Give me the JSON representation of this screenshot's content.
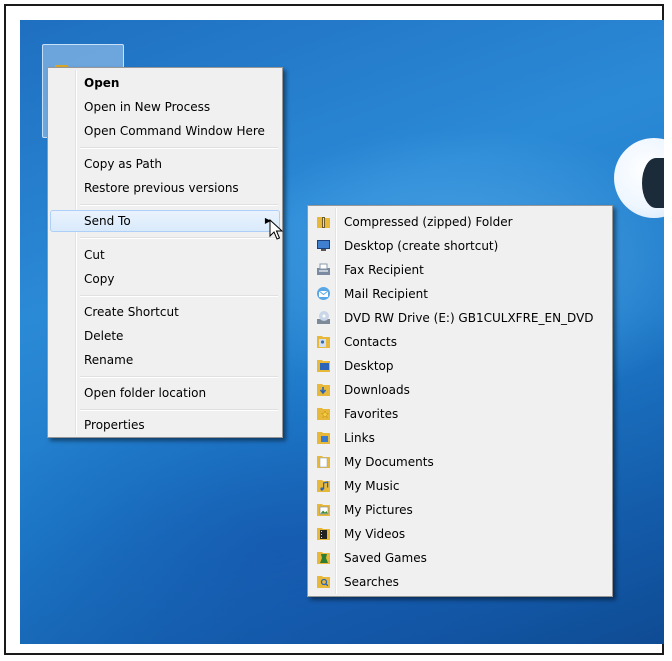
{
  "context_menu": {
    "items": [
      {
        "label": "Open"
      },
      {
        "label": "Open in New Process"
      },
      {
        "label": "Open Command Window Here"
      },
      {
        "label": "Copy as Path"
      },
      {
        "label": "Restore previous versions"
      },
      {
        "label": "Send To"
      },
      {
        "label": "Cut"
      },
      {
        "label": "Copy"
      },
      {
        "label": "Create Shortcut"
      },
      {
        "label": "Delete"
      },
      {
        "label": "Rename"
      },
      {
        "label": "Open folder location"
      },
      {
        "label": "Properties"
      }
    ],
    "highlighted": "Send To",
    "submenu_arrow": "▶"
  },
  "send_to_menu": {
    "items": [
      {
        "label": "Compressed (zipped) Folder",
        "icon": "zip-folder-icon"
      },
      {
        "label": "Desktop (create shortcut)",
        "icon": "desktop-icon"
      },
      {
        "label": "Fax Recipient",
        "icon": "fax-icon"
      },
      {
        "label": "Mail Recipient",
        "icon": "mail-icon"
      },
      {
        "label": "DVD RW Drive (E:) GB1CULXFRE_EN_DVD",
        "icon": "dvd-drive-icon"
      },
      {
        "label": "Contacts",
        "icon": "contacts-folder-icon"
      },
      {
        "label": "Desktop",
        "icon": "desktop-folder-icon"
      },
      {
        "label": "Downloads",
        "icon": "downloads-folder-icon"
      },
      {
        "label": "Favorites",
        "icon": "favorites-folder-icon"
      },
      {
        "label": "Links",
        "icon": "links-folder-icon"
      },
      {
        "label": "My Documents",
        "icon": "documents-folder-icon"
      },
      {
        "label": "My Music",
        "icon": "music-folder-icon"
      },
      {
        "label": "My Pictures",
        "icon": "pictures-folder-icon"
      },
      {
        "label": "My Videos",
        "icon": "videos-folder-icon"
      },
      {
        "label": "Saved Games",
        "icon": "saved-games-folder-icon"
      },
      {
        "label": "Searches",
        "icon": "searches-folder-icon"
      }
    ]
  },
  "colors": {
    "menu_bg": "#f0f0f0",
    "menu_border": "#979797",
    "highlight_bg": "#dbeafb",
    "highlight_border": "#aecff7",
    "folder_yellow": "#e8b83a",
    "desktop_blue": "#1d79c8"
  }
}
